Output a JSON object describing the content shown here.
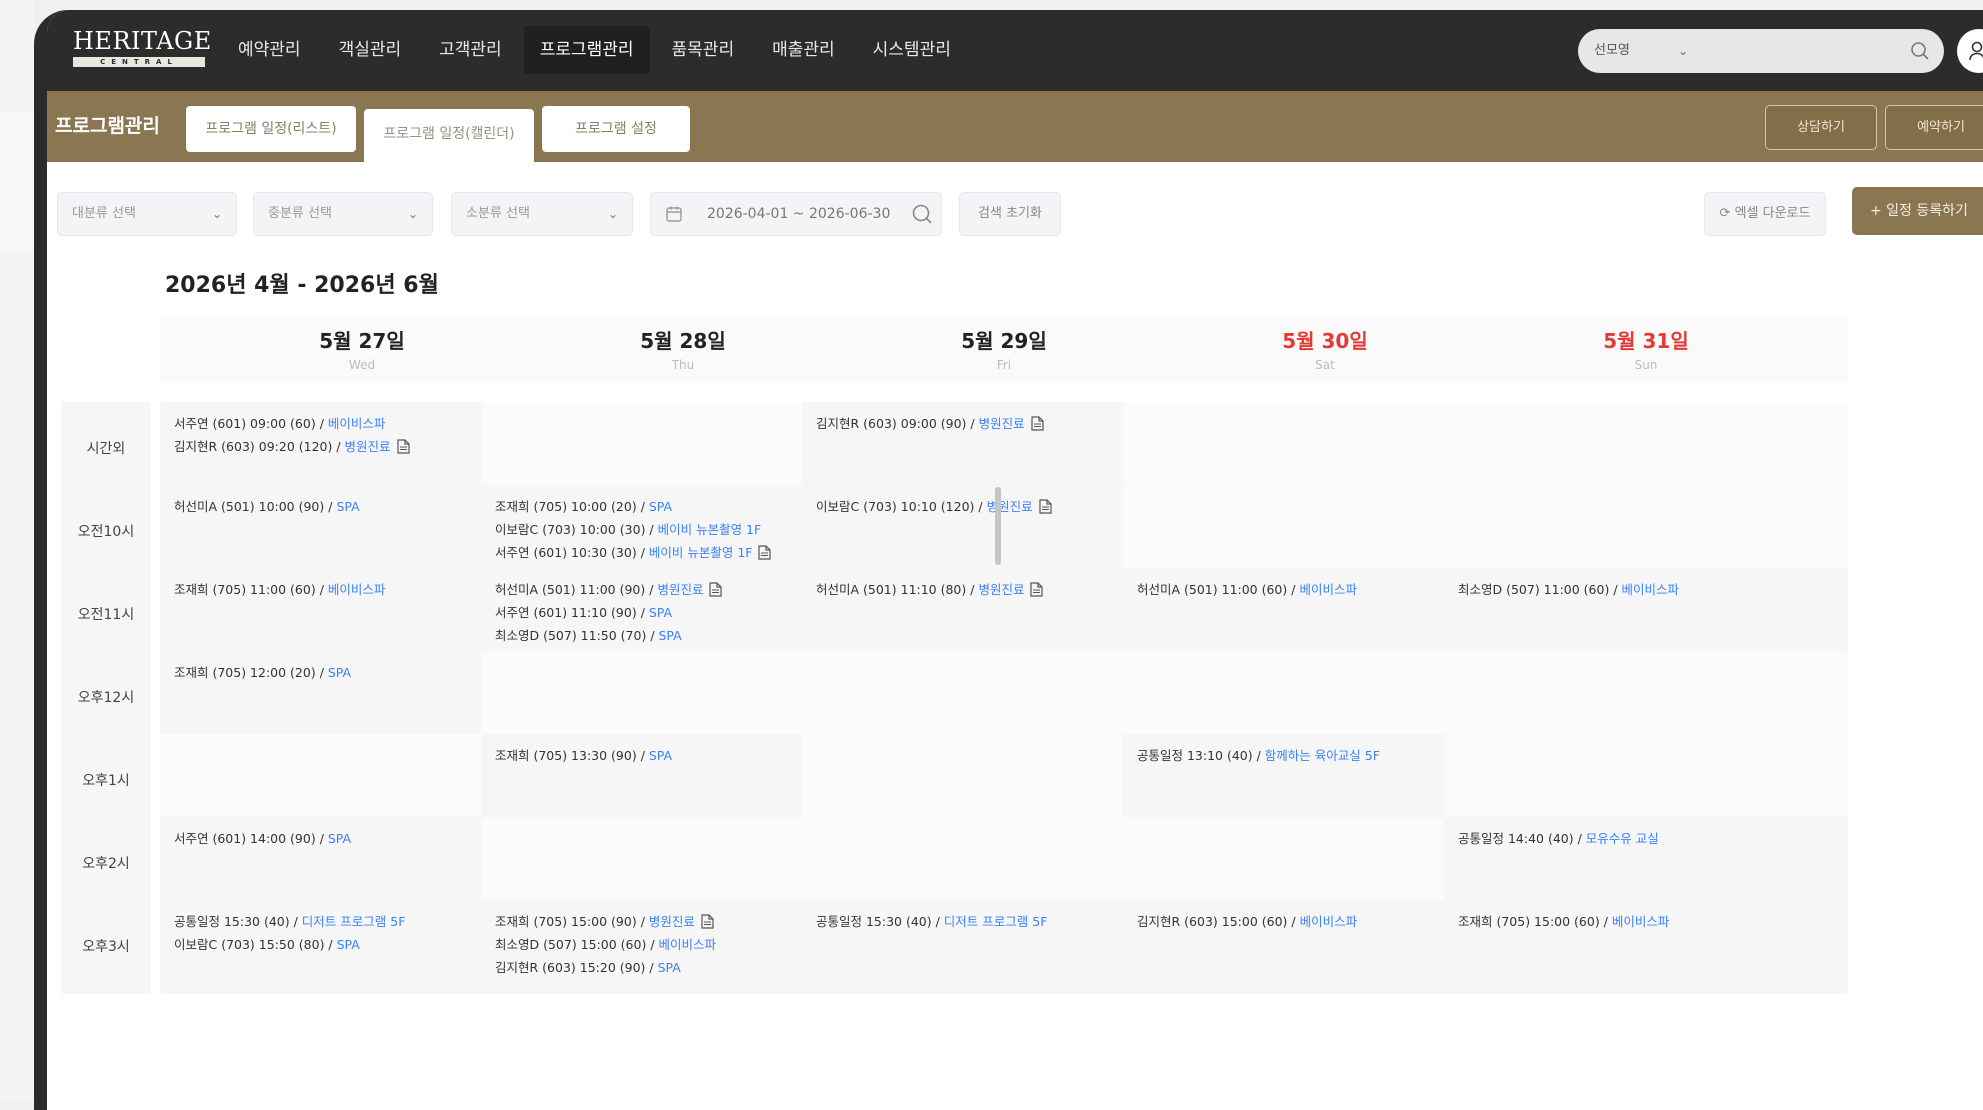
{
  "logo": {
    "main": "HERITAGE",
    "sub": "CENTRAL"
  },
  "nav": {
    "menu": [
      "예약관리",
      "객실관리",
      "고객관리",
      "프로그램관리",
      "품목관리",
      "매출관리",
      "시스템관리"
    ],
    "active_index": 3,
    "search_select": "선모영"
  },
  "subheader": {
    "title": "프로그램관리",
    "tabs": [
      "프로그램 일정(리스트)",
      "프로그램 일정(캘린더)",
      "프로그램 설정"
    ],
    "active_tab": 1,
    "buttons": [
      "상담하기",
      "예약하기"
    ]
  },
  "filters": {
    "category_major": "대분류 선택",
    "category_mid": "중분류 선택",
    "category_minor": "소분류 선택",
    "date_range": "2026-04-01 ~ 2026-06-30",
    "reset_label": "검색 초기화",
    "excel_label": "엑셀 다운로드",
    "register_label": "+ 일정 등록하기"
  },
  "calendar": {
    "range_title": "2026년 4월 - 2026년 6월",
    "days": [
      {
        "date": "5월 27일",
        "weekday": "Wed",
        "kind": "weekday"
      },
      {
        "date": "5월 28일",
        "weekday": "Thu",
        "kind": "weekday"
      },
      {
        "date": "5월 29일",
        "weekday": "Fri",
        "kind": "weekday"
      },
      {
        "date": "5월 30일",
        "weekday": "Sat",
        "kind": "sat"
      },
      {
        "date": "5월 31일",
        "weekday": "Sun",
        "kind": "sun"
      }
    ],
    "rows": [
      "시간외",
      "오전10시",
      "오전11시",
      "오후12시",
      "오후1시",
      "오후2시",
      "오후3시"
    ],
    "events": [
      [
        [
          {
            "text": "서주연 (601) 09:00 (60) / ",
            "program": "베이비스파",
            "doc": false
          },
          {
            "text": "김지현R (603) 09:20 (120) / ",
            "program": "병원진료",
            "doc": true
          }
        ],
        [],
        [
          {
            "text": "김지현R (603) 09:00 (90) / ",
            "program": "병원진료",
            "doc": true
          }
        ],
        [],
        []
      ],
      [
        [
          {
            "text": "허선미A (501) 10:00 (90) / ",
            "program": "SPA",
            "doc": false
          }
        ],
        [
          {
            "text": "조재희 (705) 10:00 (20) / ",
            "program": "SPA",
            "doc": false
          },
          {
            "text": "이보람C (703) 10:00 (30) / ",
            "program": "베이비 뉴본촬영 1F",
            "doc": false
          },
          {
            "text": "서주연 (601) 10:30 (30) / ",
            "program": "베이비 뉴본촬영 1F",
            "doc": true
          }
        ],
        [
          {
            "text": "이보람C (703) 10:10 (120) / ",
            "program": "병원진료",
            "doc": true
          }
        ],
        [],
        []
      ],
      [
        [
          {
            "text": "조재희 (705) 11:00 (60) / ",
            "program": "베이비스파",
            "doc": false
          }
        ],
        [
          {
            "text": "허선미A (501) 11:00 (90) / ",
            "program": "병원진료",
            "doc": true
          },
          {
            "text": "서주연 (601) 11:10 (90) / ",
            "program": "SPA",
            "doc": false
          },
          {
            "text": "최소영D (507) 11:50 (70) / ",
            "program": "SPA",
            "doc": false
          }
        ],
        [
          {
            "text": "허선미A (501) 11:10 (80) / ",
            "program": "병원진료",
            "doc": true
          }
        ],
        [
          {
            "text": "허선미A (501) 11:00 (60) / ",
            "program": "베이비스파",
            "doc": false
          }
        ],
        [
          {
            "text": "최소영D (507) 11:00 (60) / ",
            "program": "베이비스파",
            "doc": false
          }
        ]
      ],
      [
        [
          {
            "text": "조재희 (705) 12:00 (20) / ",
            "program": "SPA",
            "doc": false
          }
        ],
        [],
        [],
        [],
        []
      ],
      [
        [],
        [
          {
            "text": "조재희 (705) 13:30 (90) / ",
            "program": "SPA",
            "doc": false
          }
        ],
        [],
        [
          {
            "text": "공통일정 13:10 (40) / ",
            "program": "함께하는 육아교실 5F",
            "doc": false
          }
        ],
        []
      ],
      [
        [
          {
            "text": "서주연 (601) 14:00 (90) / ",
            "program": "SPA",
            "doc": false
          }
        ],
        [],
        [],
        [],
        [
          {
            "text": "공통일정 14:40 (40) / ",
            "program": "모유수유 교실",
            "doc": false
          }
        ]
      ],
      [
        [
          {
            "text": "공통일정 15:30 (40) / ",
            "program": "디저트 프로그램 5F",
            "doc": false
          },
          {
            "text": "이보람C (703) 15:50 (80) / ",
            "program": "SPA",
            "doc": false
          }
        ],
        [
          {
            "text": "조재희 (705) 15:00 (90) / ",
            "program": "병원진료",
            "doc": true
          },
          {
            "text": "최소영D (507) 15:00 (60) / ",
            "program": "베이비스파",
            "doc": false
          },
          {
            "text": "김지현R (603) 15:20 (90) / ",
            "program": "SPA",
            "doc": false
          }
        ],
        [
          {
            "text": "공통일정 15:30 (40) / ",
            "program": "디저트 프로그램 5F",
            "doc": false
          }
        ],
        [
          {
            "text": "김지현R (603) 15:00 (60) / ",
            "program": "베이비스파",
            "doc": false
          }
        ],
        [
          {
            "text": "조재희 (705) 15:00 (60) / ",
            "program": "베이비스파",
            "doc": false
          }
        ]
      ]
    ]
  },
  "colors": {
    "nav_bg": "#2c2c2c",
    "brand_gold": "#8a7651",
    "link_blue": "#3b82f6",
    "weekend_red": "#e53935"
  }
}
